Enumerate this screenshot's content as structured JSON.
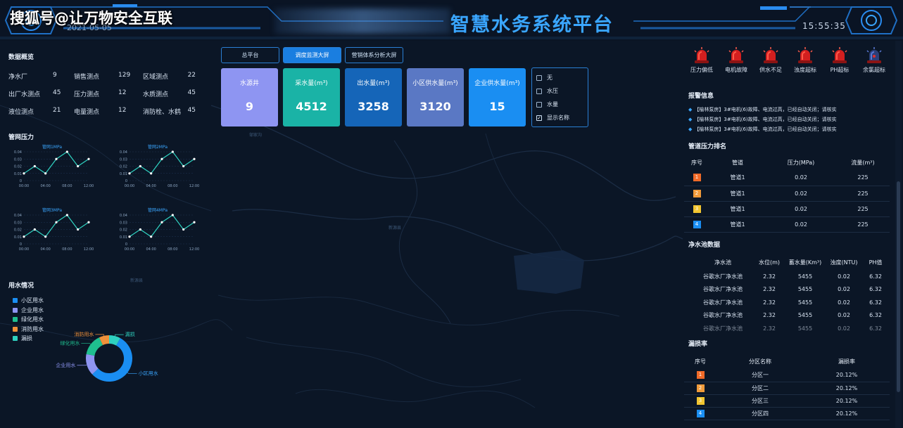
{
  "watermark": "搜狐号@让万物安全互联",
  "header": {
    "title": "智慧水务系统平台",
    "date": "2021-05-05",
    "clock": "15:55:35"
  },
  "overview": {
    "title": "数据概览",
    "rows": [
      [
        {
          "label": "净水厂",
          "value": "9"
        },
        {
          "label": "销售测点",
          "value": "129"
        },
        {
          "label": "区域测点",
          "value": "22"
        }
      ],
      [
        {
          "label": "出厂水测点",
          "value": "45"
        },
        {
          "label": "压力测点",
          "value": "12"
        },
        {
          "label": "水质测点",
          "value": "45"
        }
      ],
      [
        {
          "label": "液位测点",
          "value": "21"
        },
        {
          "label": "电量测点",
          "value": "12"
        },
        {
          "label": "消防栓、水鹤",
          "value": "45"
        }
      ]
    ]
  },
  "pressure": {
    "title": "管网压力"
  },
  "usage": {
    "title": "用水情况"
  },
  "tabs": [
    {
      "label": "总平台",
      "active": false
    },
    {
      "label": "调度监测大屏",
      "active": true
    },
    {
      "label": "营销体系分析大屏",
      "active": false
    }
  ],
  "kpis": [
    {
      "label": "水源井",
      "value": "9",
      "color": "#8e95f2"
    },
    {
      "label": "采水量(m³)",
      "value": "4512",
      "color": "#1ab3a6"
    },
    {
      "label": "出水量(m³)",
      "value": "3258",
      "color": "#1565b8"
    },
    {
      "label": "小区供水量(m³)",
      "value": "3120",
      "color": "#5a78c4"
    },
    {
      "label": "企业供水量(m³)",
      "value": "15",
      "color": "#1a8ef2"
    }
  ],
  "filters": [
    {
      "label": "无",
      "checked": false
    },
    {
      "label": "水压",
      "checked": false
    },
    {
      "label": "水量",
      "checked": false
    },
    {
      "label": "显示名称",
      "checked": true
    }
  ],
  "map_labels": [
    "邹家沟",
    "新源县",
    "新源县"
  ],
  "alarms": [
    {
      "label": "压力偏低",
      "icon": "siren-red-icon"
    },
    {
      "label": "电机故障",
      "icon": "siren-red-icon"
    },
    {
      "label": "供水不足",
      "icon": "siren-red-icon"
    },
    {
      "label": "浊度超标",
      "icon": "siren-red-icon"
    },
    {
      "label": "PH超标",
      "icon": "siren-red-icon"
    },
    {
      "label": "余氯超标",
      "icon": "siren-blue-icon"
    }
  ],
  "alert_info": {
    "title": "报警信息",
    "items": [
      "【榆林泵房】3#电机(6)故障、电流过高，已经自动关闭；请核实",
      "【榆林泵房】3#电机(6)故障、电流过高，已经自动关闭；请核实",
      "【榆林泵房】3#电机(6)故障、电流过高，已经自动关闭；请核实"
    ]
  },
  "pipe_rank": {
    "title": "管道压力排名",
    "headers": [
      "序号",
      "管道",
      "压力(MPa)",
      "流量(m³)"
    ],
    "rows": [
      {
        "rank": "1",
        "pipe": "管道1",
        "pressure": "0.02",
        "flow": "225",
        "color": "#f06a28"
      },
      {
        "rank": "2",
        "pipe": "管道1",
        "pressure": "0.02",
        "flow": "225",
        "color": "#f09a3a"
      },
      {
        "rank": "3",
        "pipe": "管道1",
        "pressure": "0.02",
        "flow": "225",
        "color": "#f2c530"
      },
      {
        "rank": "4",
        "pipe": "管道1",
        "pressure": "0.02",
        "flow": "225",
        "color": "#1a8ef2"
      }
    ]
  },
  "pool": {
    "title": "净水池数据",
    "headers": [
      "净水池",
      "水位(m)",
      "蓄水量(Km³)",
      "浊度(NTU)",
      "PH值"
    ],
    "rows": [
      [
        "谷歌水厂净水池",
        "2.32",
        "5455",
        "0.02",
        "6.32"
      ],
      [
        "谷歌水厂净水池",
        "2.32",
        "5455",
        "0.02",
        "6.32"
      ],
      [
        "谷歌水厂净水池",
        "2.32",
        "5455",
        "0.02",
        "6.32"
      ],
      [
        "谷歌水厂净水池",
        "2.32",
        "5455",
        "0.02",
        "6.32"
      ],
      [
        "谷歌水厂净水池",
        "2.32",
        "5455",
        "0.02",
        "6.32"
      ]
    ]
  },
  "leak": {
    "title": "漏损率",
    "headers": [
      "序号",
      "分区名称",
      "漏损率"
    ],
    "rows": [
      {
        "rank": "1",
        "zone": "分区一",
        "rate": "20.12%",
        "color": "#f06a28"
      },
      {
        "rank": "2",
        "zone": "分区二",
        "rate": "20.12%",
        "color": "#f09a3a"
      },
      {
        "rank": "3",
        "zone": "分区三",
        "rate": "20.12%",
        "color": "#f2c530"
      },
      {
        "rank": "4",
        "zone": "分区四",
        "rate": "20.12%",
        "color": "#1a8ef2"
      }
    ]
  },
  "chart_data": [
    {
      "type": "line",
      "title": "管网1MPa",
      "x": [
        "00:00",
        "02:00",
        "04:00",
        "06:00",
        "08:00",
        "10:00",
        "12:00"
      ],
      "values": [
        0.01,
        0.02,
        0.01,
        0.03,
        0.04,
        0.02,
        0.03
      ],
      "yticks": [
        "0",
        "0.01",
        "0.02",
        "0.03",
        "0.04"
      ],
      "xticks": [
        "00:00",
        "04:00",
        "08:00",
        "12:00"
      ],
      "ylim": [
        0,
        0.04
      ],
      "color": "#2fd1c0"
    },
    {
      "type": "line",
      "title": "管网2MPa",
      "x": [
        "00:00",
        "02:00",
        "04:00",
        "06:00",
        "08:00",
        "10:00",
        "12:00"
      ],
      "values": [
        0.01,
        0.02,
        0.01,
        0.03,
        0.04,
        0.02,
        0.03
      ],
      "yticks": [
        "0",
        "0.01",
        "0.02",
        "0.03",
        "0.04"
      ],
      "xticks": [
        "00:00",
        "04:00",
        "08:00",
        "12:00"
      ],
      "ylim": [
        0,
        0.04
      ],
      "color": "#2fd1c0"
    },
    {
      "type": "line",
      "title": "管网3MPa",
      "x": [
        "00:00",
        "02:00",
        "04:00",
        "06:00",
        "08:00",
        "10:00",
        "12:00"
      ],
      "values": [
        0.01,
        0.02,
        0.01,
        0.03,
        0.04,
        0.02,
        0.03
      ],
      "yticks": [
        "0",
        "0.01",
        "0.02",
        "0.03",
        "0.04"
      ],
      "xticks": [
        "00:00",
        "04:00",
        "08:00",
        "12:00"
      ],
      "ylim": [
        0,
        0.04
      ],
      "color": "#2fd1c0"
    },
    {
      "type": "line",
      "title": "管网4MPa",
      "x": [
        "00:00",
        "02:00",
        "04:00",
        "06:00",
        "08:00",
        "10:00",
        "12:00"
      ],
      "values": [
        0.01,
        0.02,
        0.01,
        0.03,
        0.04,
        0.02,
        0.03
      ],
      "yticks": [
        "0",
        "0.01",
        "0.02",
        "0.03",
        "0.04"
      ],
      "xticks": [
        "00:00",
        "04:00",
        "08:00",
        "12:00"
      ],
      "ylim": [
        0,
        0.04
      ],
      "color": "#2fd1c0"
    },
    {
      "type": "pie",
      "categories": [
        "小区用水",
        "企业用水",
        "绿化用水",
        "消防用水",
        "漏损"
      ],
      "values": [
        55,
        15,
        15,
        7,
        8
      ],
      "colors": [
        "#1a8ef2",
        "#8e95f2",
        "#1fbf8f",
        "#f0913a",
        "#2fd1c0"
      ],
      "label_colors": [
        "#3aa6ff",
        "#8e95f2",
        "#1fbf8f",
        "#f0913a",
        "#2fd1c0"
      ]
    }
  ]
}
